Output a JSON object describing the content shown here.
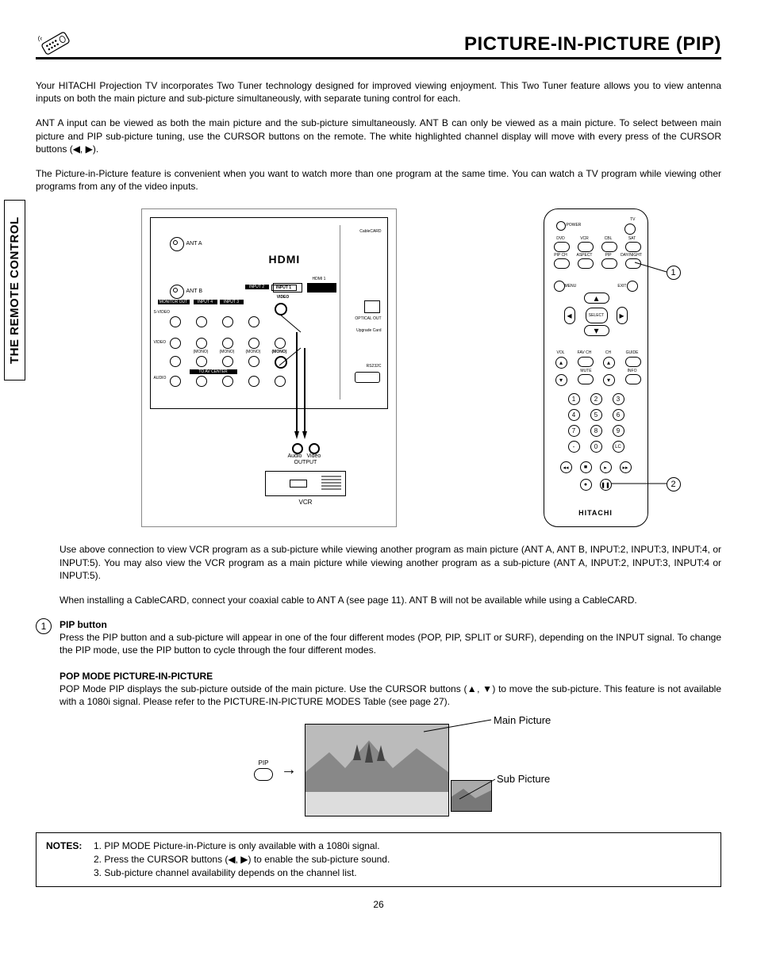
{
  "header": {
    "title": "PICTURE-IN-PICTURE (PIP)"
  },
  "side_tab": "THE REMOTE CONTROL",
  "paragraphs": {
    "p1": "Your HITACHI Projection TV incorporates Two Tuner technology designed for improved viewing enjoyment. This Two Tuner feature allows you to view antenna inputs on both the main picture and sub-picture simultaneously, with separate tuning control for each.",
    "p2": "ANT A input can be viewed as both the main picture and the sub-picture simultaneously.  ANT B can only be viewed as a main picture. To select between main picture and PIP sub-picture tuning, use the CURSOR buttons on the remote.  The white highlighted channel display will move with every press of the CURSOR buttons (◀, ▶).",
    "p3": "The Picture-in-Picture feature is convenient when you want to watch more than one program at the same time.  You can watch a TV program while viewing other programs from any of the video inputs.",
    "p4": "Use above connection to view VCR program as a sub-picture while viewing another program as main picture (ANT A, ANT B, INPUT:2, INPUT:3, INPUT:4, or INPUT:5). You may also view the VCR program as a main picture while viewing another program as a sub-picture (ANT A, INPUT:2, INPUT:3, INPUT:4 or INPUT:5).",
    "p5": "When installing a CableCARD, connect your coaxial cable to ANT A (see page 11). ANT B will not be available while using a CableCARD."
  },
  "sections": {
    "s1": {
      "num": "1",
      "head": "PIP button",
      "body": "Press the PIP button and a sub-picture will appear in one of the four different modes (POP, PIP, SPLIT or SURF), depending on the INPUT signal.  To change the PIP mode, use the PIP button to cycle through the four different modes."
    },
    "s2": {
      "head": "POP MODE PICTURE-IN-PICTURE",
      "body": "POP Mode PIP displays the sub-picture outside of the main picture.  Use the CURSOR buttons (▲, ▼) to move the sub-picture. This feature is not available with a 1080i signal.  Please refer to the PICTURE-IN-PICTURE MODES Table (see page 27)."
    }
  },
  "pip_demo": {
    "btn": "PIP",
    "main": "Main Picture",
    "sub": "Sub Picture"
  },
  "notes": {
    "head": "NOTES:",
    "n1": "1.  PIP MODE Picture-in-Picture is only available with a 1080i signal.",
    "n2": "2.  Press the CURSOR buttons (◀, ▶) to enable the sub-picture sound.",
    "n3": "3.  Sub-picture channel availability depends on the channel list."
  },
  "page_num": "26",
  "remote": {
    "power": "POWER",
    "tv": "TV",
    "dvd": "DVD",
    "vcr": "VCR",
    "cbl": "CBL",
    "sat": "SAT",
    "pipch": "PIP CH",
    "aspect": "ASPECT",
    "pip": "PIP",
    "daynight": "DAY/NIGHT",
    "menu": "MENU",
    "exit": "EXIT",
    "select": "SELECT",
    "vol": "VOL",
    "favch": "FAV CH",
    "ch": "CH",
    "guide": "GUIDE",
    "mute": "MUTE",
    "info": "INFO",
    "lc": "LC",
    "brand": "HITACHI"
  },
  "panel": {
    "hdmi": "HDMI",
    "anta": "ANT A",
    "antb": "ANT B",
    "hdmi1": "HDMI 1",
    "input1": "INPUT 1",
    "input2": "INPUT 2",
    "video": "VIDEO",
    "monitor": "MONITOR OUT",
    "input4": "INPUT 4",
    "input3": "INPUT 3",
    "svideo": "S-VIDEO",
    "mono": "(MONO)",
    "audio": "AUDIO",
    "center": "TO AV CENTER",
    "rs232c": "RS232C",
    "optical": "OPTICAL OUT",
    "cablecard": "CableCARD",
    "upgrade": "Upgrade Card",
    "audio_out": "Audio",
    "video_out": "Video",
    "output": "OUTPUT",
    "vcr": "VCR"
  }
}
